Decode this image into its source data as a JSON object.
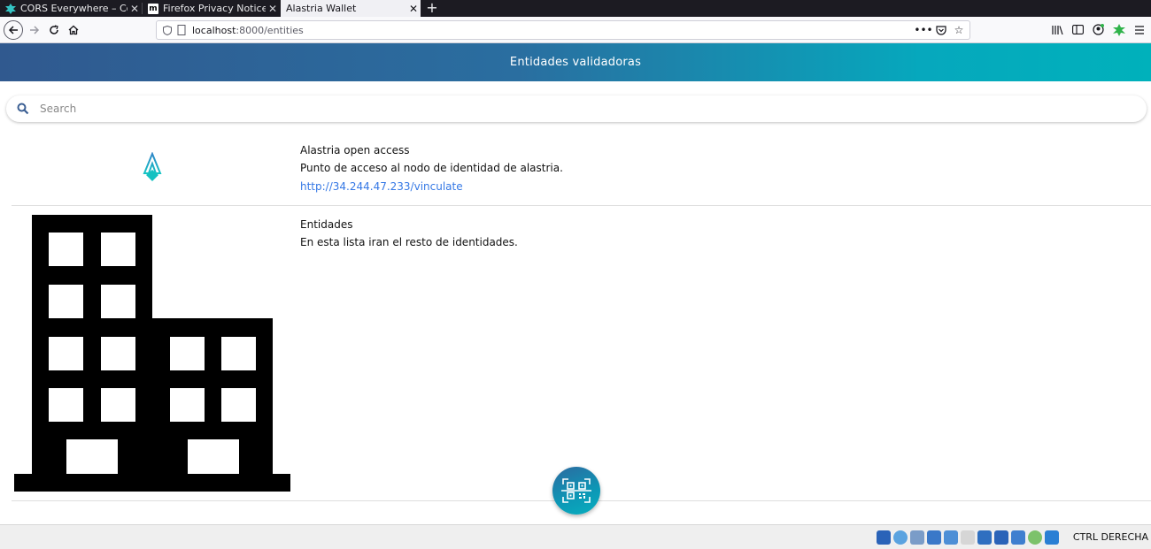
{
  "browser": {
    "tabs": [
      {
        "title": "CORS Everywhere – Con",
        "active": false
      },
      {
        "title": "Firefox Privacy Notice —",
        "active": false
      },
      {
        "title": "Alastria Wallet",
        "active": true
      }
    ],
    "url_host": "localhost",
    "url_path": ":8000/entities",
    "new_tab_label": "+"
  },
  "app": {
    "header_title": "Entidades validadoras",
    "search_placeholder": "Search",
    "entities": [
      {
        "name": "Alastria open access",
        "description": "Punto de acceso al nodo de identidad de alastria.",
        "link": "http://34.244.47.233/vinculate",
        "icon": "alastria-logo-icon"
      },
      {
        "name": "Entidades",
        "description": "En esta lista iran el resto de identidades.",
        "icon": "building-icon"
      }
    ],
    "fab_icon": "qr-scan-icon"
  },
  "statusbar": {
    "text": "CTRL DERECHA"
  },
  "colors": {
    "header_gradient_start": "#30598f",
    "header_gradient_end": "#00b1bb",
    "link": "#3578e5"
  }
}
